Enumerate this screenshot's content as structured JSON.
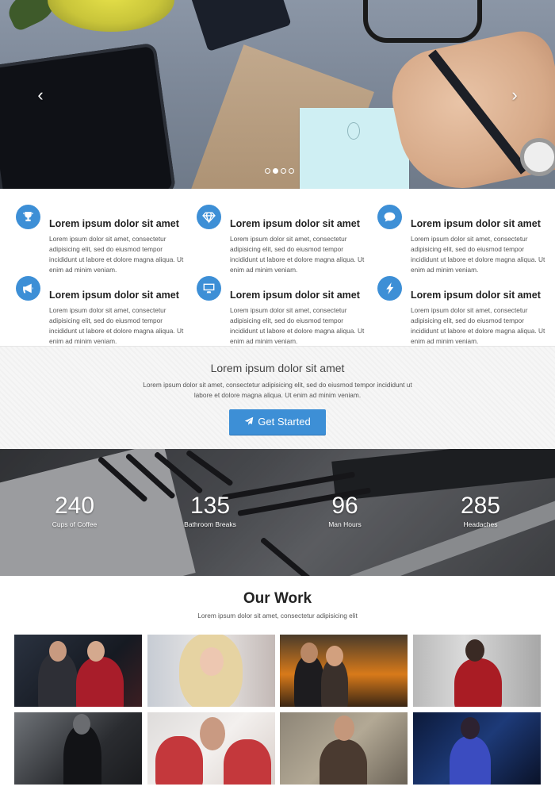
{
  "hero": {
    "prev_glyph": "‹",
    "next_glyph": "›",
    "slides": [
      {
        "active": false
      },
      {
        "active": true
      },
      {
        "active": false
      },
      {
        "active": false
      }
    ]
  },
  "features": [
    {
      "icon": "trophy-icon",
      "title": "Lorem ipsum dolor sit amet",
      "text": "Lorem ipsum dolor sit amet, consectetur adipisicing elit, sed do eiusmod tempor incididunt ut labore et dolore magna aliqua. Ut enim ad minim veniam."
    },
    {
      "icon": "diamond-icon",
      "title": "Lorem ipsum dolor sit amet",
      "text": "Lorem ipsum dolor sit amet, consectetur adipisicing elit, sed do eiusmod tempor incididunt ut labore et dolore magna aliqua. Ut enim ad minim veniam."
    },
    {
      "icon": "comment-icon",
      "title": "Lorem ipsum dolor sit amet",
      "text": "Lorem ipsum dolor sit amet, consectetur adipisicing elit, sed do eiusmod tempor incididunt ut labore et dolore magna aliqua. Ut enim ad minim veniam."
    },
    {
      "icon": "bullhorn-icon",
      "title": "Lorem ipsum dolor sit amet",
      "text": "Lorem ipsum dolor sit amet, consectetur adipisicing elit, sed do eiusmod tempor incididunt ut labore et dolore magna aliqua. Ut enim ad minim veniam."
    },
    {
      "icon": "desktop-icon",
      "title": "Lorem ipsum dolor sit amet",
      "text": "Lorem ipsum dolor sit amet, consectetur adipisicing elit, sed do eiusmod tempor incididunt ut labore et dolore magna aliqua. Ut enim ad minim veniam."
    },
    {
      "icon": "bolt-icon",
      "title": "Lorem ipsum dolor sit amet",
      "text": "Lorem ipsum dolor sit amet, consectetur adipisicing elit, sed do eiusmod tempor incididunt ut labore et dolore magna aliqua. Ut enim ad minim veniam."
    }
  ],
  "cta": {
    "title": "Lorem ipsum dolor sit amet",
    "text": "Lorem ipsum dolor sit amet, consectetur adipisicing elit, sed do eiusmod tempor incididunt ut labore et dolore magna aliqua. Ut enim ad minim veniam.",
    "button_label": "Get Started",
    "button_icon": "paper-plane-icon"
  },
  "stats": [
    {
      "number": "240",
      "label": "Cups of Coffee"
    },
    {
      "number": "135",
      "label": "Bathroom Breaks"
    },
    {
      "number": "96",
      "label": "Man Hours"
    },
    {
      "number": "285",
      "label": "Headaches"
    }
  ],
  "work": {
    "title": "Our Work",
    "subtitle": "Lorem ipsum dolor sit amet, consectetur adipisicing elit"
  },
  "colors": {
    "accent": "#3d8fd6",
    "heading": "#222222",
    "body_text": "#555555"
  }
}
